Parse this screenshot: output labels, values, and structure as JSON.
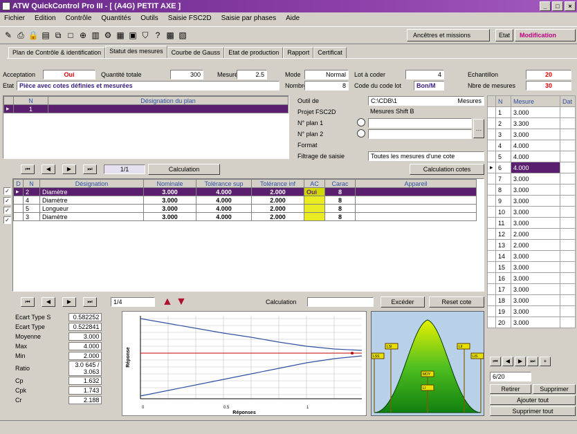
{
  "window": {
    "title": "ATW QuickControl Pro III - [ (A4G) PETIT AXE ]"
  },
  "menu": [
    "Fichier",
    "Edition",
    "Contrôle",
    "Quantités",
    "Outils",
    "Saisie FSC2D",
    "Saisie par phases",
    "Aide"
  ],
  "toolbar": {
    "mode_label": "Ancêtres et missions",
    "etat_label": "Etat",
    "etat_value": "Modification"
  },
  "tabs": [
    "Plan de Contrôle & identification",
    "Statut des mesures",
    "Courbe de Gauss",
    "Etat de production",
    "Rapport",
    "Certificat"
  ],
  "header": {
    "acceptation_label": "Acceptation",
    "acceptation_value": "Oui",
    "quantite_label": "Quantité totale",
    "quantite_value": "300",
    "mesures_label": "Mesurés",
    "mesures_value": "2.5",
    "mode_label": "Mode",
    "mode_value": "Normal",
    "lot_label": "Lot à coder",
    "lot_value": "4",
    "echantillon_label": "Echantillon",
    "echantillon_value": "20",
    "nombre_label": "Nombre",
    "nombre_value": "8",
    "code_label": "Code du code lot",
    "code_value": "Bon/M",
    "nbre_mesures_label": "Nbre de mesures",
    "nbre_mesures_value": "30",
    "etat_label": "Etat",
    "etat_value": "Pièce avec cotes définies et mesurées"
  },
  "plan_table": {
    "headers": [
      "N",
      "Désignation du plan"
    ],
    "rows": [
      {
        "n": "1",
        "designation": ""
      }
    ]
  },
  "right_fields": {
    "outil_label": "Outil de",
    "outil_value": "C:\\CDB\\1",
    "outil_extra": "Mesures",
    "projet_label": "Projet FSC2D",
    "projet_value": "Mesures Shift B",
    "plan1_label": "N° plan 1",
    "plan1_value": "",
    "plan2_label": "N° plan 2",
    "plan2_value": "",
    "format_label": "Format",
    "filtrage_label": "Filtrage de saisie",
    "filtrage_value": "Toutes les mesures d'une cote"
  },
  "nav_top": {
    "position": "1/1",
    "calc_label": "Calculation",
    "calc_btn": "Calculation cotes"
  },
  "cotes_table": {
    "headers": [
      "D",
      "N",
      "Désignation",
      "Nominale",
      "Tolérance sup",
      "Tolérance inf",
      "AC",
      "Carac",
      "Appareil"
    ],
    "rows": [
      {
        "n": "2",
        "designation": "Diamètre",
        "nominal": "3.000",
        "tol_sup": "4.000",
        "tol_inf": "2.000",
        "ac": "Oui",
        "carac": "8",
        "appareil": "",
        "selected": true
      },
      {
        "n": "4",
        "designation": "Diamètre",
        "nominal": "3.000",
        "tol_sup": "4.000",
        "tol_inf": "2.000",
        "ac": "",
        "carac": "8",
        "appareil": "",
        "selected": false
      },
      {
        "n": "5",
        "designation": "Longueur",
        "nominal": "3.000",
        "tol_sup": "4.000",
        "tol_inf": "2.000",
        "ac": "",
        "carac": "8",
        "appareil": "",
        "selected": false
      },
      {
        "n": "3",
        "designation": "Diamètre",
        "nominal": "3.000",
        "tol_sup": "4.000",
        "tol_inf": "2.000",
        "ac": "",
        "carac": "8",
        "appareil": "",
        "selected": false
      }
    ]
  },
  "nav_bottom": {
    "position": "1/4",
    "calc_label": "Calculation",
    "btn_a": "Excéder",
    "btn_b": "Reset cote"
  },
  "stats": [
    {
      "label": "Ecart Type S",
      "value": "0.582252"
    },
    {
      "label": "Ecart Type",
      "value": "0.522841"
    },
    {
      "label": "Moyenne",
      "value": "3.000"
    },
    {
      "label": "Max",
      "value": "4.000"
    },
    {
      "label": "Min",
      "value": "2.000"
    },
    {
      "label": "Ratio",
      "value": "3.0 645 / 3.063"
    },
    {
      "label": "Cp",
      "value": "1.632"
    },
    {
      "label": "Cpk",
      "value": "1.743"
    },
    {
      "label": "Cr",
      "value": "2.188"
    }
  ],
  "chart": {
    "xlabel": "Réponses",
    "ylabel": "Réponse"
  },
  "gauss_labels": [
    "LSI",
    "LII",
    "LSS",
    "LIS",
    "MOY",
    "LI"
  ],
  "mesures_table": {
    "headers": [
      "N",
      "Mesure",
      "Dat"
    ],
    "rows": [
      {
        "n": "1",
        "v": "3.000"
      },
      {
        "n": "2",
        "v": "3.300"
      },
      {
        "n": "3",
        "v": "3.000"
      },
      {
        "n": "4",
        "v": "4.000"
      },
      {
        "n": "5",
        "v": "4.000"
      },
      {
        "n": "6",
        "v": "4.000",
        "selected": true
      },
      {
        "n": "7",
        "v": "3.000"
      },
      {
        "n": "8",
        "v": "3.000"
      },
      {
        "n": "9",
        "v": "3.000"
      },
      {
        "n": "10",
        "v": "3.000"
      },
      {
        "n": "11",
        "v": "3.000"
      },
      {
        "n": "12",
        "v": "2.000"
      },
      {
        "n": "13",
        "v": "2.000"
      },
      {
        "n": "14",
        "v": "3.000"
      },
      {
        "n": "15",
        "v": "3.000"
      },
      {
        "n": "16",
        "v": "3.000"
      },
      {
        "n": "17",
        "v": "3.000"
      },
      {
        "n": "18",
        "v": "3.000"
      },
      {
        "n": "19",
        "v": "3.000"
      },
      {
        "n": "20",
        "v": "3.000"
      }
    ]
  },
  "mesures_footer": {
    "position": "6/20",
    "btn_retirer": "Retirer",
    "btn_supprimer": "Supprimer",
    "btn_ajouter": "Ajouter tout",
    "btn_suppr_tout": "Supprimer tout"
  }
}
